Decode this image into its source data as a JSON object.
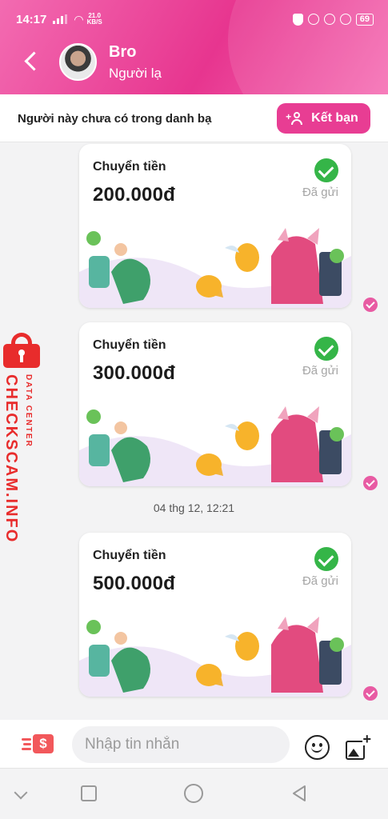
{
  "status_bar": {
    "time": "14:17",
    "net_speed_value": "21.0",
    "net_speed_unit": "KB/S",
    "battery": "69"
  },
  "header": {
    "contact_name": "Bro",
    "contact_subtitle": "Người lạ"
  },
  "notice": {
    "text": "Người này chưa có trong danh bạ",
    "add_friend_label": "Kết bạn"
  },
  "messages": [
    {
      "title": "Chuyển tiền",
      "amount": "200.000đ",
      "status": "Đã gửi"
    },
    {
      "title": "Chuyển tiền",
      "amount": "300.000đ",
      "status": "Đã gửi"
    },
    {
      "title": "Chuyển tiền",
      "amount": "500.000đ",
      "status": "Đã gửi"
    }
  ],
  "timestamp": "04 thg 12, 12:21",
  "watermark": {
    "brand": "CHECKSCAM.INFO",
    "sub": "DATA CENTER"
  },
  "input_bar": {
    "placeholder": "Nhập tin nhắn",
    "money_symbol": "$"
  },
  "colors": {
    "brand_pink": "#e83d93",
    "check_green": "#35b548",
    "watermark_red": "#e82c2c"
  }
}
